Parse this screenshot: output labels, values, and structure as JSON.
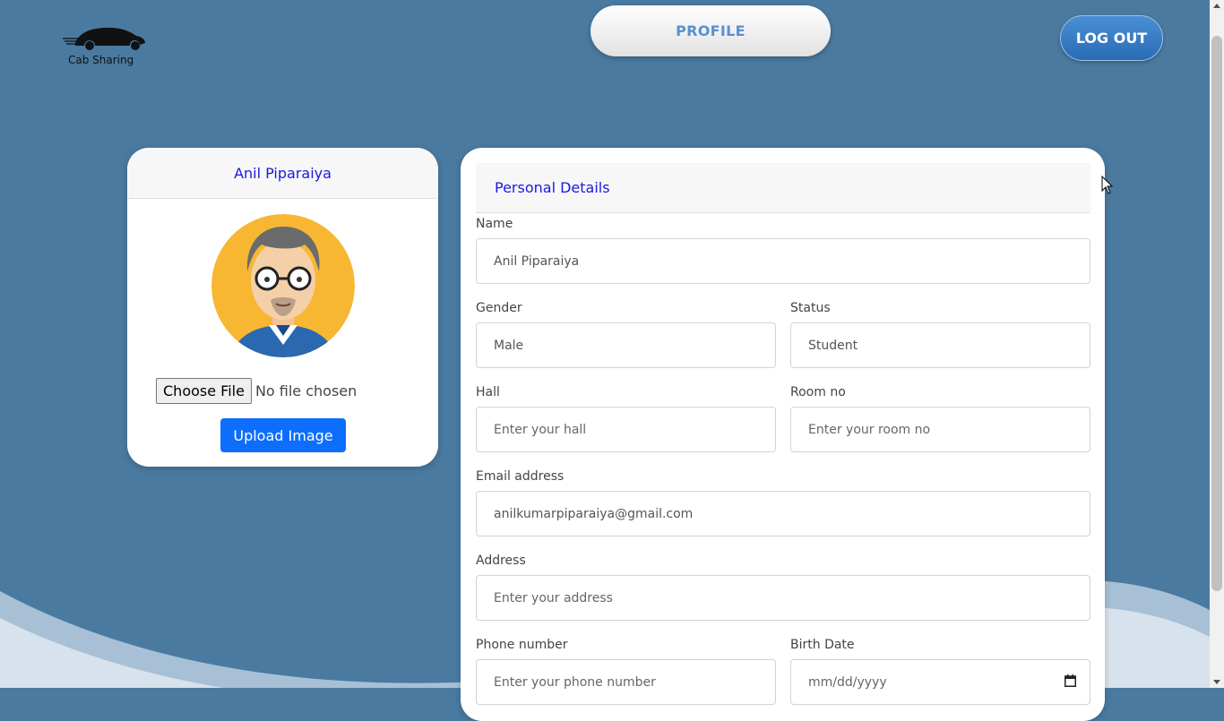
{
  "header": {
    "logo_text": "Cab Sharing",
    "profile_label": "PROFILE",
    "logout_label": "LOG OUT"
  },
  "profile_card": {
    "name": "Anil Piparaiya",
    "choose_file_label": "Choose File",
    "no_file_text": "No file chosen",
    "upload_label": "Upload Image"
  },
  "personal_details": {
    "title": "Personal Details",
    "name": {
      "label": "Name",
      "value": "Anil Piparaiya"
    },
    "gender": {
      "label": "Gender",
      "value": "Male"
    },
    "status": {
      "label": "Status",
      "value": "Student"
    },
    "hall": {
      "label": "Hall",
      "placeholder": "Enter your hall"
    },
    "room": {
      "label": "Room no",
      "placeholder": "Enter your room no"
    },
    "email": {
      "label": "Email address",
      "value": "anilkumarpiparaiya@gmail.com"
    },
    "address": {
      "label": "Address",
      "placeholder": "Enter your address"
    },
    "phone": {
      "label": "Phone number",
      "placeholder": "Enter your phone number"
    },
    "birth_date": {
      "label": "Birth Date",
      "placeholder": "mm/dd/yyyy"
    }
  },
  "colors": {
    "background": "#4a7aa0",
    "accent_blue": "#0d6efd",
    "heading_blue": "#1a1adf",
    "profile_text": "#5b8fd0"
  }
}
